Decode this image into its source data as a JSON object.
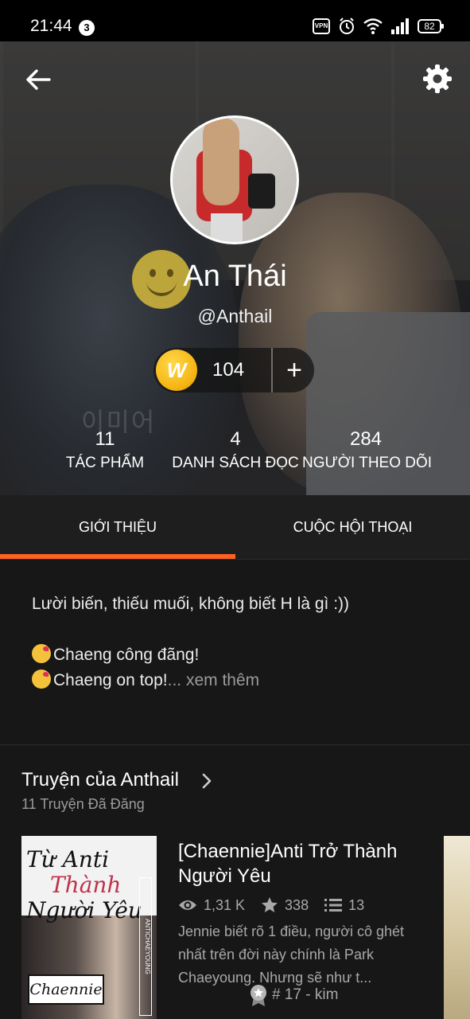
{
  "status_bar": {
    "time": "21:44",
    "notification_count": "3",
    "vpn_label": "VPN",
    "battery": "82"
  },
  "profile": {
    "display_name": "An Thái",
    "username": "@Anthail",
    "coins": "104",
    "watermark": "이미어"
  },
  "stats": [
    {
      "value": "11",
      "label": "TÁC PHẨM"
    },
    {
      "value": "4",
      "label": "DANH SÁCH ĐỌC"
    },
    {
      "value": "284",
      "label": "NGƯỜI THEO DÕI"
    }
  ],
  "tabs": [
    {
      "label": "GIỚI THIỆU",
      "active": true
    },
    {
      "label": "CUỘC HỘI THOẠI",
      "active": false
    }
  ],
  "about": {
    "line1": "Lười biến, thiếu muối, không biết H là gì :))",
    "line2": "Chaeng công đãng!",
    "line3": "Chaeng on top!",
    "see_more": "... xem thêm"
  },
  "stories": {
    "title": "Truyện của Anthail",
    "count": "11 Truyện Đã Đăng",
    "items": [
      {
        "title": "[Chaennie]Anti Trở Thành Người Yêu",
        "reads": "1,31 K",
        "votes": "338",
        "parts": "13",
        "description": "Jennie biết rõ 1 điều, người cô ghét nhất trên đời này chính là Park Chaeyoung. Nhưng sẽ như t...",
        "rank": "# 17 - kim",
        "cover_line1": "Từ Anti",
        "cover_line2": "Thành",
        "cover_line3": "Người Yêu",
        "cover_tag": "Chaennie",
        "cover_side": "ANTICHAEYOUNG"
      }
    ]
  },
  "colors": {
    "accent": "#ff6122",
    "background": "#121212",
    "coin": "#f5b514"
  }
}
